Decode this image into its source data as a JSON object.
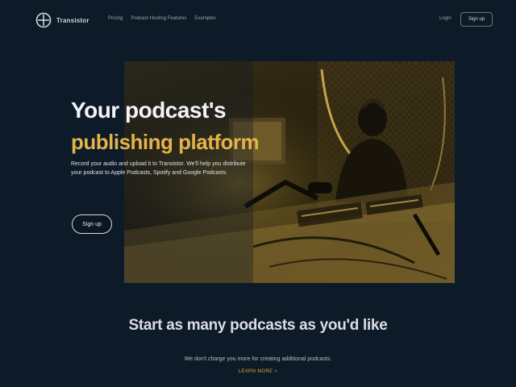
{
  "header": {
    "brand": "Transistor",
    "nav": [
      "Pricing",
      "Podcast Hosting Features",
      "Examples"
    ],
    "login": "Login",
    "signup": "Sign up"
  },
  "hero": {
    "title_line1": "Your podcast's",
    "title_line2": "publishing platform",
    "description": "Record your audio and upload it to Transistor. We'll help you distribute your podcast to Apple Podcasts, Spotify and Google Podcasts.",
    "signup": "Sign up",
    "image": "podcast-studio-photo"
  },
  "section": {
    "title": "Start as many podcasts as you'd like",
    "description": "We don't charge you more for creating additional podcasts.",
    "learn_more": "LEARN MORE >"
  },
  "colors": {
    "background": "#0d1a27",
    "accent": "#e4b348",
    "text": "#f2f4f7"
  }
}
